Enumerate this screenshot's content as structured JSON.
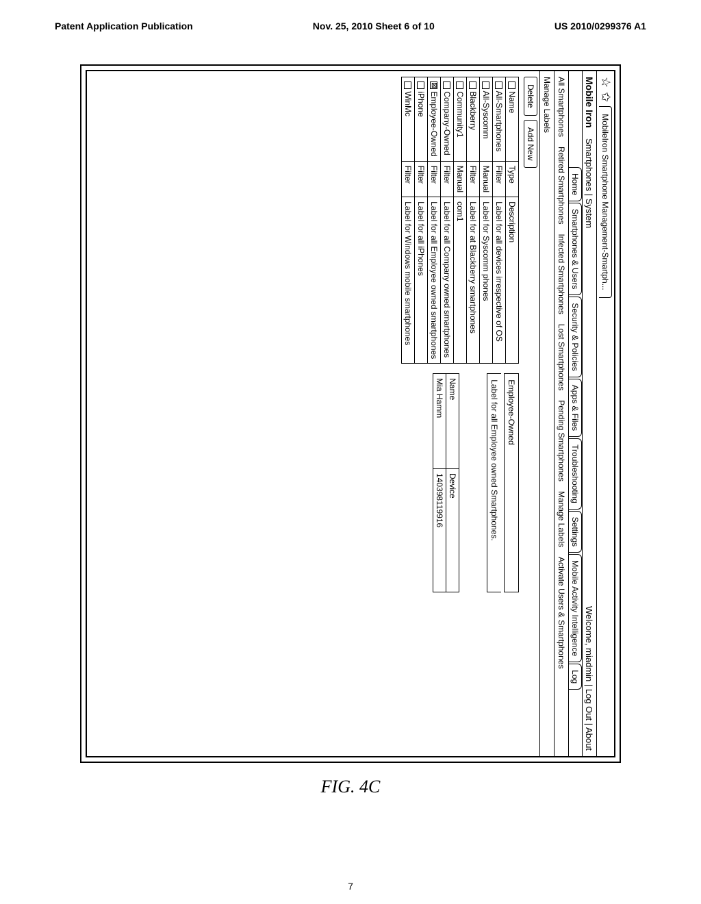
{
  "header": {
    "left": "Patent Application Publication",
    "center": "Nov. 25, 2010  Sheet 6 of 10",
    "right": "US 2010/0299376 A1"
  },
  "browser_tab": "MobileIron Smartphone Management-Smartph...",
  "logo": "Mobile Iron",
  "top_menu": "Smartphones | System",
  "welcome": "Welcome, miadmin | Log Out | About",
  "main_tabs": [
    "Home",
    "Smartphones & Users",
    "Security & Policies",
    "Apps & Files",
    "Troubleshooting",
    "Settings",
    "Mobile Activity Intelligence",
    "Log"
  ],
  "sub_links": [
    "All Smartphones",
    "Retired Smartphones",
    "Infected Smartphones",
    "Lost Smartphones",
    "Pending Smartphones",
    "Manage Labels",
    "Activate Users & Smartphones"
  ],
  "section_title": "Manage Labels",
  "buttons": {
    "delete": "Delete",
    "add_new": "Add New"
  },
  "labels_table": {
    "headers": [
      "Name",
      "Type",
      "Description"
    ],
    "rows": [
      {
        "checked": false,
        "name": "All-Smartphones",
        "type": "Filter",
        "desc": "Label for all devices irrespective of OS"
      },
      {
        "checked": false,
        "name": "All-Syscomm",
        "type": "Manual",
        "desc": "Label for Syscomm phones"
      },
      {
        "checked": false,
        "name": "Blackberry",
        "type": "Filter",
        "desc": "Label for at Blackberry smartphones"
      },
      {
        "checked": false,
        "name": "Community1",
        "type": "Manual",
        "desc": "com1"
      },
      {
        "checked": false,
        "name": "Company-Owned",
        "type": "Filter",
        "desc": "Label for all Company owned smartphones"
      },
      {
        "checked": true,
        "name": "Employee-Owned",
        "type": "Filter",
        "desc": "Label for all Employee owned smartphones"
      },
      {
        "checked": false,
        "name": "iPhone",
        "type": "Filter",
        "desc": "Label for all iPhones"
      },
      {
        "checked": false,
        "name": "WinMc",
        "type": "Filter",
        "desc": "Label for Windows mobile smartphones"
      }
    ]
  },
  "side": {
    "title": "Employee-Owned",
    "desc": "Label for all Employee owned Smartphones.",
    "table_headers": [
      "Name",
      "Device"
    ],
    "table_rows": [
      {
        "name": "Mia Hamm",
        "device": "140398119916"
      }
    ]
  },
  "figure_caption": "FIG. 4C",
  "page_number": "7"
}
